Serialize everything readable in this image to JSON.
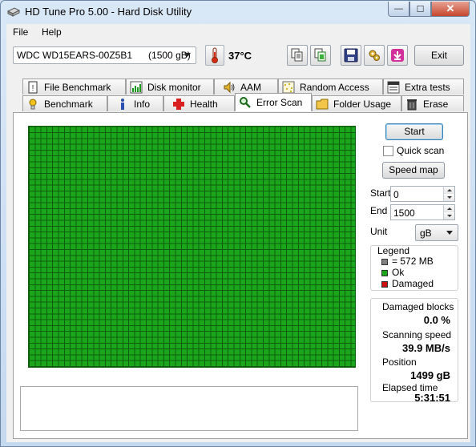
{
  "window": {
    "title": "HD Tune Pro 5.00 - Hard Disk Utility",
    "controls": {
      "minimize": "—",
      "maximize": "☐",
      "close": "✕"
    }
  },
  "menu": {
    "file": "File",
    "help": "Help"
  },
  "toolbar": {
    "drive": "WDC WD15EARS-00Z5B1      (1500 gB)",
    "temperature": "37°C",
    "exit_label": "Exit",
    "icons": [
      "copy-icon",
      "copy-report-icon",
      "save-icon",
      "settings-icon",
      "download-icon"
    ]
  },
  "tabs": {
    "top_row": [
      {
        "label": "File Benchmark",
        "icon": "file-benchmark-icon"
      },
      {
        "label": "Disk monitor",
        "icon": "disk-monitor-icon"
      },
      {
        "label": "AAM",
        "icon": "speaker-icon"
      },
      {
        "label": "Random Access",
        "icon": "random-access-icon"
      },
      {
        "label": "Extra tests",
        "icon": "extra-tests-icon"
      }
    ],
    "bottom_row": [
      {
        "label": "Benchmark",
        "icon": "benchmark-icon"
      },
      {
        "label": "Info",
        "icon": "info-icon"
      },
      {
        "label": "Health",
        "icon": "health-icon"
      },
      {
        "label": "Error Scan",
        "icon": "magnifier-icon",
        "active": true
      },
      {
        "label": "Folder Usage",
        "icon": "folder-icon"
      },
      {
        "label": "Erase",
        "icon": "trash-icon"
      }
    ]
  },
  "error_scan": {
    "start_button": "Start",
    "quick_scan_label": "Quick scan",
    "quick_scan_checked": false,
    "speed_map_button": "Speed map",
    "start_label": "Start",
    "start_value": "0",
    "end_label": "End",
    "end_value": "1500",
    "unit_label": "Unit",
    "unit_value": "gB",
    "legend": {
      "title": "Legend",
      "items": [
        {
          "label": "= 572 MB",
          "color": "#808080"
        },
        {
          "label": "Ok",
          "color": "#1aa51a"
        },
        {
          "label": "Damaged",
          "color": "#d01010"
        }
      ]
    },
    "stats": {
      "damaged_blocks_label": "Damaged blocks",
      "damaged_blocks_value": "0.0 %",
      "scanning_speed_label": "Scanning speed",
      "scanning_speed_value": "39.9 MB/s",
      "position_label": "Position",
      "position_value": "1499 gB",
      "elapsed_label": "Elapsed time",
      "elapsed_value": "5:31:51"
    },
    "map": {
      "cell_color": "#1aa51a",
      "grid_color": "#0d5f0d",
      "status": "all blocks ok"
    }
  }
}
